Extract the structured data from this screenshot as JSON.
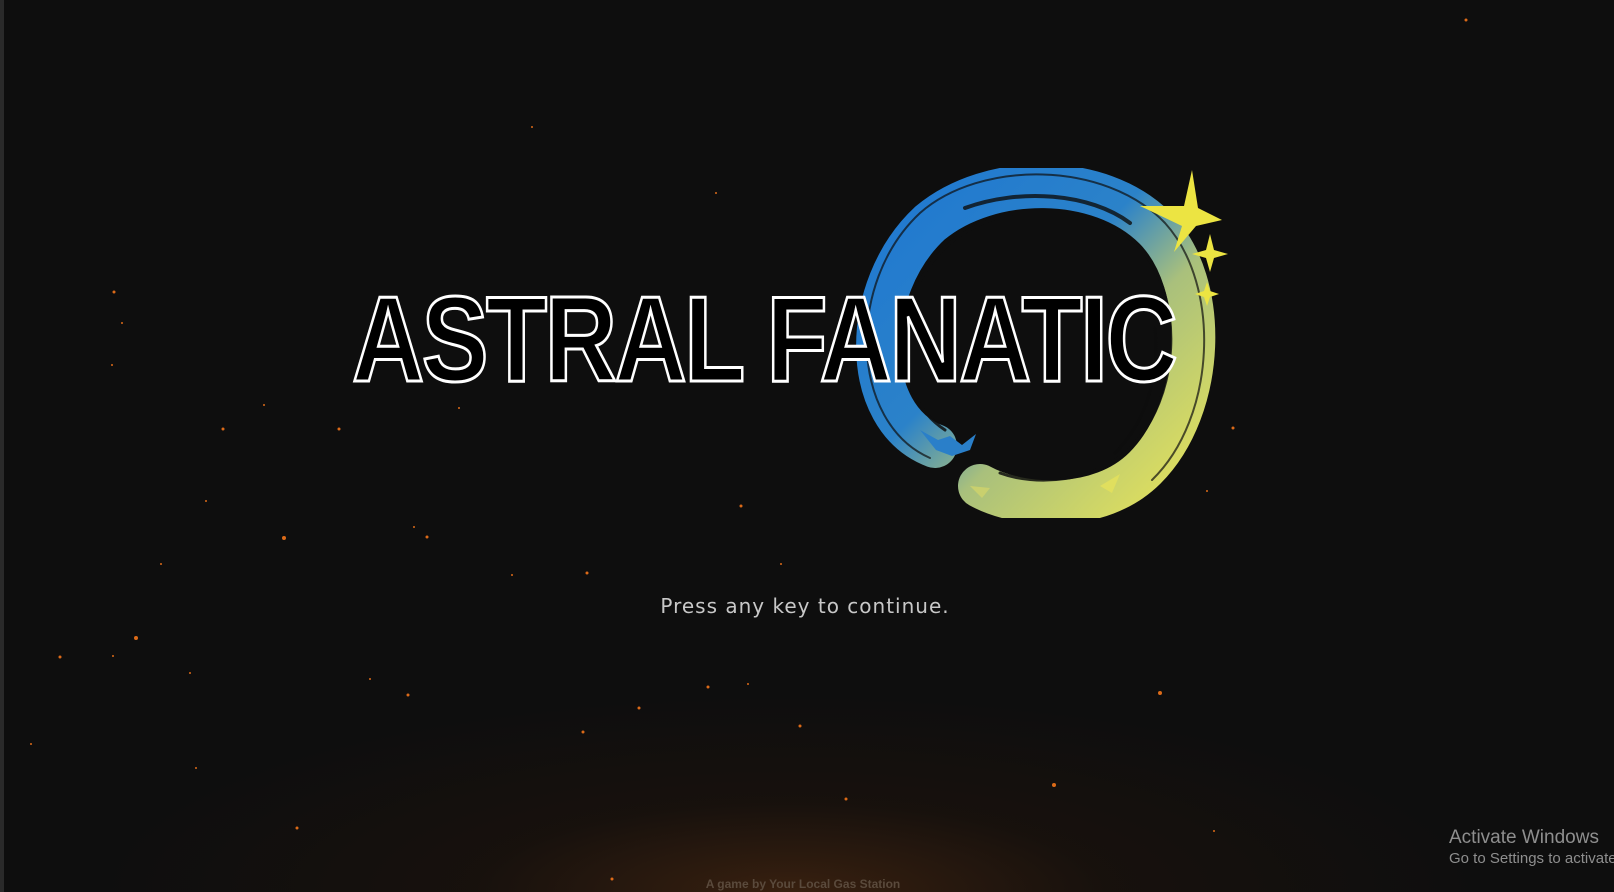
{
  "title_screen": {
    "game_title": "ASTRAL FANATIC",
    "prompt": "Press any key to continue.",
    "credits": "A game by Your Local Gas Station"
  },
  "logo": {
    "ring_gradient": [
      "#1f78d1",
      "#2b82c9",
      "#c7d06a",
      "#e4e259"
    ],
    "star_color": "#ece442",
    "icons": [
      "brush-ring-icon",
      "sparkle-star-icon"
    ]
  },
  "windows_watermark": {
    "title": "Activate Windows",
    "subtitle": "Go to Settings to activate"
  },
  "colors": {
    "background": "#0e0e0e",
    "ember": "#ff7a1a",
    "glow": "#46260f",
    "prompt_text": "#c8c8c8",
    "credits_text": "#5a4a3c"
  }
}
